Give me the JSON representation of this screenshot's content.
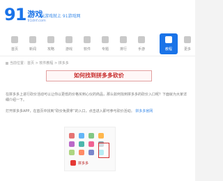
{
  "header": {
    "logo_number": "91",
    "logo_text": "游戏",
    "logo_sub": "91dnf.com",
    "tagline": "玩游戏就上 91游戏网"
  },
  "nav": {
    "items": [
      {
        "label": "首页"
      },
      {
        "label": "新闻"
      },
      {
        "label": "攻略"
      },
      {
        "label": "游戏"
      },
      {
        "label": "软件"
      },
      {
        "label": "专题"
      },
      {
        "label": "排行"
      },
      {
        "label": "手游"
      },
      {
        "label": "教程"
      },
      {
        "label": "更多"
      }
    ],
    "active_index": 8
  },
  "breadcrumb": "当前位置：首页 > 软件教程 > 拼多多",
  "article": {
    "title": "如何找到拼多多砍价",
    "p1": "在拼多多上进行砍价活动可以让你以更低的价格买到心仪的商品，那么如何找到拼多多的砍价入口呢？下面就为大家详细介绍一下。",
    "p2_text": "打开拼多多APP，在首页中找到“砍价免费拿”的入口，点击进入即可参与砍价活动。",
    "p2_link": "拼多多官网"
  },
  "screenshot": {
    "footer_text": "拼多多"
  },
  "colors": {
    "brand": "#1a73e8",
    "title_red": "#c62828",
    "highlight": "#d32f2f"
  }
}
